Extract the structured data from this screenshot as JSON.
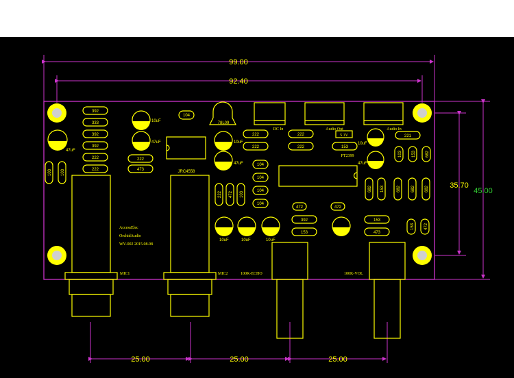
{
  "colors": {
    "background": "#000000",
    "silkscreen": "#ffff00",
    "board_outline": "#cc33cc",
    "dimension_line": "#cc33cc",
    "dimension_text": "#ffff00",
    "dimension_text_alt": "#33cc33"
  },
  "dimensions": {
    "overall_width": "99.00",
    "hole_span_width": "92.40",
    "hole_span_height": "35.70",
    "overall_height": "45.00",
    "pot_spacing_1": "25.00",
    "pot_spacing_2": "25.00",
    "pot_spacing_3": "25.00"
  },
  "resistors_left": [
    "392",
    "333",
    "392",
    "392",
    "222",
    "222"
  ],
  "caps_mid_left": [
    "222",
    "473"
  ],
  "capacitor_labels": {
    "c1": "47uF",
    "c2": "10uF",
    "c3": "47uF",
    "c4": "10uF",
    "c5": "47uF",
    "c6": "10uF",
    "c7": "10uF",
    "c8": "10uF",
    "c9": "10uF",
    "c10": "47uF"
  },
  "vertical_resistors_left": [
    "103",
    "103"
  ],
  "mid_resistors": [
    "222",
    "222",
    "222",
    "222"
  ],
  "vertical_104": [
    "104",
    "104",
    "104",
    "104",
    "104"
  ],
  "vertical_triplet": [
    "222",
    "472",
    "103"
  ],
  "board_text": {
    "chip_top": "104",
    "chip_label": "JRC4558",
    "reg_label": "78L09",
    "dc_in": "DC In",
    "audio_out": "Audio Out",
    "audio_in": "Audio In",
    "ic_main": "PT2399",
    "ic_code": "153",
    "ic_box": "5 1V",
    "brand1": "AccessElec",
    "brand2": "OrchidAudio",
    "version": "WV-002 2015.08.08",
    "mic1": "MIC1",
    "mic2": "MIC2",
    "pot_echo": "100K-ECHO",
    "pot_vol": "100K-VOL"
  },
  "right_components": {
    "r_221": "221",
    "small_vertical": [
      "103",
      "153",
      "682"
    ],
    "row_vertical": [
      "682",
      "153",
      "682",
      "682",
      "682"
    ],
    "r_472_left": "472",
    "r_472_right": "472",
    "r_392": "392",
    "r_153a": "153",
    "r_153b": "153",
    "r_473": "473",
    "r_bottom_small": [
      "153",
      "472"
    ]
  }
}
